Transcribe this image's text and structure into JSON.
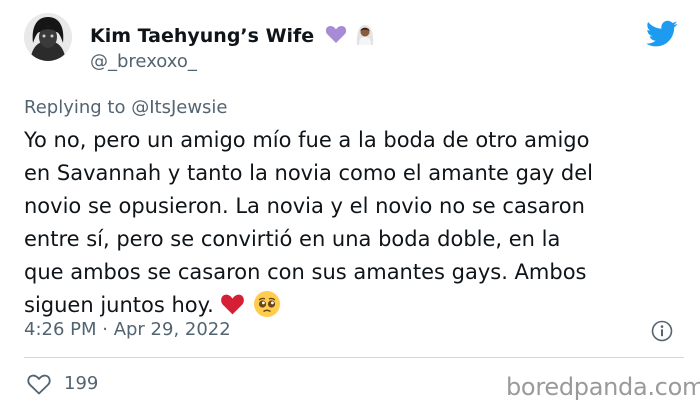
{
  "author": {
    "display_name": "Kim Taehyung’s Wife",
    "badges": [
      "purple-heart-icon",
      "person-with-veil-icon"
    ],
    "handle": "@_brexoxo_"
  },
  "reply": {
    "text": "Replying to @ItsJewsie"
  },
  "tweet": {
    "lines": [
      "Yo no, pero un amigo mío fue a la boda de otro amigo",
      "en Savannah y tanto la novia como el amante gay del",
      "novio se opusieron. La novia y el novio no se casaron",
      "entre sí, pero se convirtió en una boda doble, en la",
      "que ambos se casaron con sus amantes gays. Ambos",
      "siguen juntos hoy."
    ],
    "emojis": [
      "red-heart-icon",
      "pleading-face-icon"
    ]
  },
  "meta": {
    "timestamp": "4:26 PM · Apr 29, 2022"
  },
  "engagement": {
    "likes": "199"
  },
  "watermark": "boredpanda.com",
  "colors": {
    "twitter_blue": "#1d9bf0",
    "secondary_text": "#536471",
    "divider": "#cfd9de",
    "purple_heart": "#a78bd6",
    "red_heart": "#d61f35"
  }
}
